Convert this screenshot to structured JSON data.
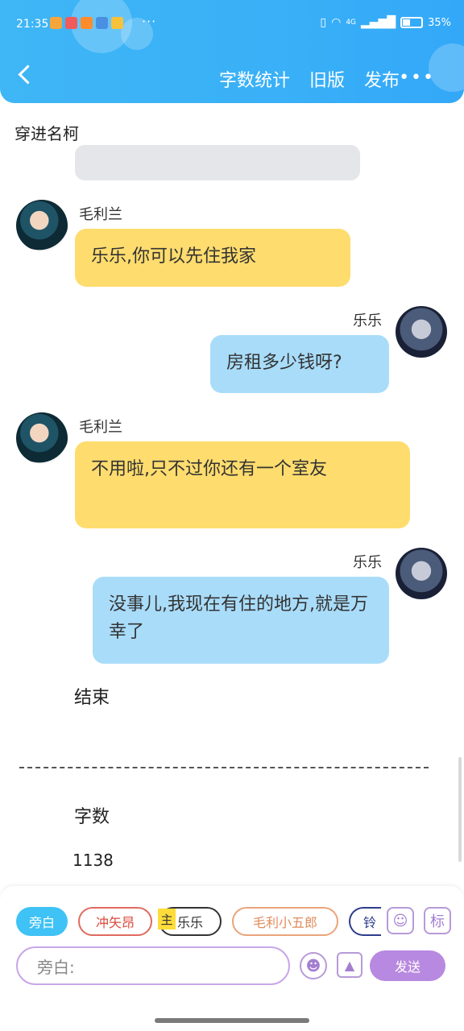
{
  "status_bar": {
    "time": "21:35",
    "more": "···",
    "network": "4G",
    "battery": "35%"
  },
  "header": {
    "actions": [
      "字数统计",
      "旧版",
      "发布"
    ],
    "more": "•••"
  },
  "chat": {
    "title": "穿进名柯",
    "messages": [
      {
        "side": "left",
        "name": "毛利兰",
        "text": "乐乐,你可以先住我家",
        "color": "#fedc6e"
      },
      {
        "side": "right",
        "name": "乐乐",
        "text": "房租多少钱呀?",
        "color": "#a9dcf9"
      },
      {
        "side": "left",
        "name": "毛利兰",
        "text": "不用啦,只不过你还有一个室友",
        "color": "#fedc6e"
      },
      {
        "side": "right",
        "name": "乐乐",
        "text": "没事儿,我现在有住的地方,就是万幸了",
        "color": "#a9dcf9"
      }
    ],
    "ending": "结束",
    "word_count_label": "字数",
    "word_count_value": "1138"
  },
  "composer": {
    "roles": [
      "旁白",
      "冲矢昂",
      "乐乐",
      "毛利小五郎",
      "铃"
    ],
    "main_tag": "主",
    "mark": "标",
    "input_placeholder": "旁白:",
    "send_label": "发送"
  },
  "colors": {
    "header_blue": "#3fb6f5",
    "yellow_bubble": "#fedc6e",
    "blue_bubble": "#a9dcf9",
    "send_purple": "#b889e0"
  },
  "icons": [
    "back-arrow-icon",
    "more-icon",
    "contact-icon",
    "emoji-icon",
    "image-icon"
  ]
}
